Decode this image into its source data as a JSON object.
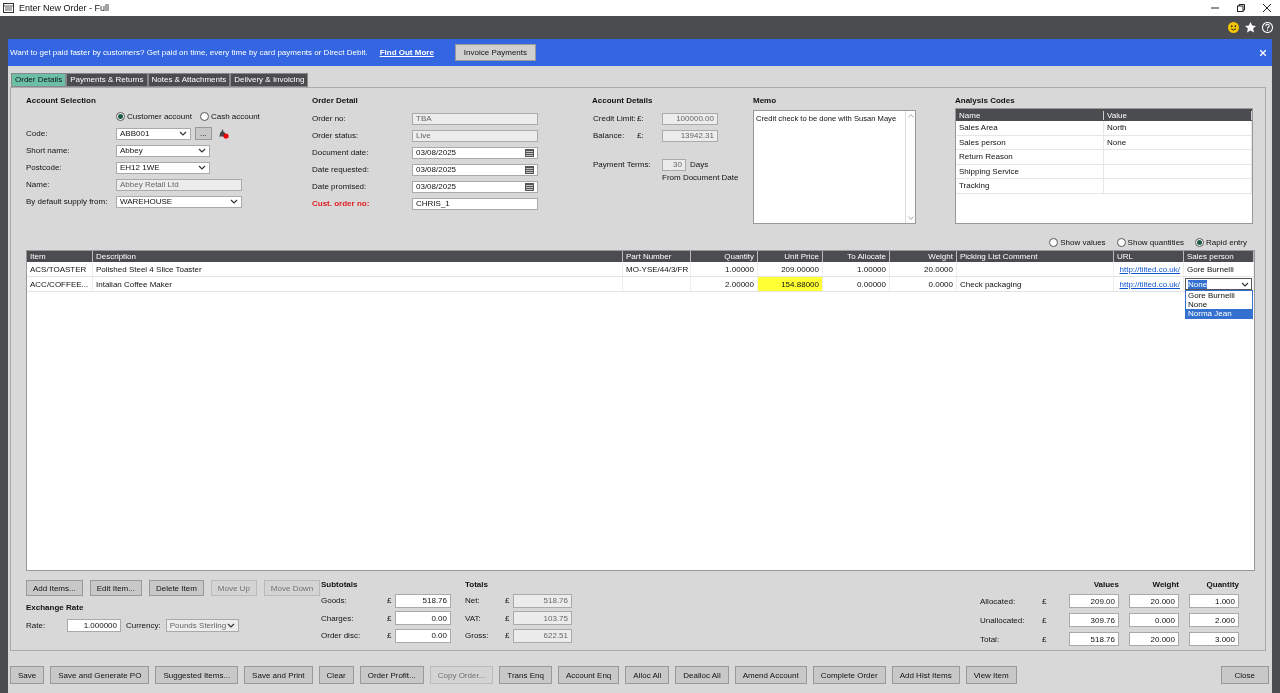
{
  "window": {
    "title": "Enter New Order - Full"
  },
  "banner": {
    "message": "Want to get paid faster by customers? Get paid on time, every time by card payments or Direct Debit.",
    "link": "Find Out More",
    "button": "Invoice Payments"
  },
  "tabs": [
    {
      "label": "Order Details",
      "selected": true
    },
    {
      "label": "Payments & Returns",
      "selected": false
    },
    {
      "label": "Notes & Attachments",
      "selected": false
    },
    {
      "label": "Delivery & Invoicing",
      "selected": false
    }
  ],
  "account_selection": {
    "title": "Account Selection",
    "lookup_button": "...",
    "account_types": [
      {
        "label": "Customer account",
        "selected": true
      },
      {
        "label": "Cash account",
        "selected": false
      }
    ],
    "fields": [
      {
        "label": "Code:",
        "value": "ABB001",
        "kind": "lookup"
      },
      {
        "label": "Short name:",
        "value": "Abbey",
        "kind": "dropdown"
      },
      {
        "label": "Postcode:",
        "value": "EH12 1WE",
        "kind": "dropdown"
      },
      {
        "label": "Name:",
        "value": "Abbey Retail Ltd",
        "kind": "readonly"
      },
      {
        "label": "By default supply from:",
        "value": "WAREHOUSE",
        "kind": "dropdown"
      }
    ]
  },
  "order_detail": {
    "title": "Order Detail",
    "fields": [
      {
        "label": "Order no:",
        "value": "TBA",
        "kind": "readonly",
        "required": false
      },
      {
        "label": "Order status:",
        "value": "Live",
        "kind": "readonly",
        "required": false
      },
      {
        "label": "Document date:",
        "value": "03/08/2025",
        "kind": "date",
        "required": false
      },
      {
        "label": "Date requested:",
        "value": "03/08/2025",
        "kind": "date",
        "required": false
      },
      {
        "label": "Date promised:",
        "value": "03/08/2025",
        "kind": "date",
        "required": false
      },
      {
        "label": "Cust. order no:",
        "value": "CHRIS_1",
        "kind": "text",
        "required": true
      }
    ]
  },
  "account_details": {
    "title": "Account Details",
    "fields": [
      {
        "label": "Credit Limit:",
        "currency": "£:",
        "value": "100000.00"
      },
      {
        "label": "Balance:",
        "currency": "£:",
        "value": "13942.31"
      }
    ],
    "payment_terms": {
      "label": "Payment Terms:",
      "value": "30",
      "unit": "Days",
      "note": "From Document Date"
    }
  },
  "memo": {
    "title": "Memo",
    "text": "Credit check to be done with Susan Maye"
  },
  "analysis_codes": {
    "title": "Analysis Codes",
    "columns": [
      "Name",
      "Value"
    ],
    "rows": [
      {
        "name": "Sales Area",
        "value": "North"
      },
      {
        "name": "Sales person",
        "value": "None"
      },
      {
        "name": "Return Reason"
      },
      {
        "name": "Shipping Service"
      },
      {
        "name": "Tracking"
      }
    ]
  },
  "view_modes": [
    {
      "label": "Show values",
      "selected": false
    },
    {
      "label": "Show quantities",
      "selected": false
    },
    {
      "label": "Rapid entry",
      "selected": true
    }
  ],
  "lines": {
    "columns": [
      "Item",
      "Description",
      "Part Number",
      "Quantity",
      "Unit Price",
      "To Allocate",
      "Weight",
      "Picking List Comment",
      "URL",
      "Sales person"
    ],
    "rows": [
      {
        "item": "ACS/TOASTER",
        "description": "Polished Steel 4 Slice Toaster",
        "part_number": "MO-YSE/44/3/FR",
        "quantity": "1.00000",
        "unit_price": "209.00000",
        "to_allocate": "1.00000",
        "weight": "20.0000",
        "url": "http://tilted.co.uk/",
        "sales_person": "Gore Burnelli",
        "price_warning": false,
        "editing": false
      },
      {
        "item": "ACC/COFFEE...",
        "description": "Intalian Coffee Maker",
        "quantity": "2.00000",
        "unit_price": "154.88000",
        "to_allocate": "0.00000",
        "weight": "0.0000",
        "comment": "Check packaging",
        "url": "http://tilted.co.uk/",
        "sales_person": "None",
        "price_warning": true,
        "editing": true,
        "options": [
          {
            "label": "Gore Burnelli",
            "selected": false
          },
          {
            "label": "None",
            "selected": false
          },
          {
            "label": "Norma Jean",
            "selected": true
          }
        ]
      }
    ]
  },
  "item_buttons": [
    {
      "label": "Add Items...",
      "disabled": false
    },
    {
      "label": "Edit Item...",
      "disabled": false
    },
    {
      "label": "Delete Item",
      "disabled": false
    },
    {
      "label": "Move Up",
      "disabled": true
    },
    {
      "label": "Move Down",
      "disabled": true
    }
  ],
  "exchange_rate": {
    "title": "Exchange Rate",
    "rate_label": "Rate:",
    "rate": "1.000000",
    "currency_label": "Currency:",
    "currency": "Pounds Sterling"
  },
  "subtotals": {
    "title": "Subtotals",
    "rows": [
      {
        "label": "Goods:",
        "currency": "£",
        "value": "518.76"
      },
      {
        "label": "Charges:",
        "currency": "£",
        "value": "0.00"
      },
      {
        "label": "Order disc:",
        "currency": "£",
        "value": "0.00"
      }
    ]
  },
  "totals": {
    "title": "Totals",
    "rows": [
      {
        "label": "Net:",
        "currency": "£",
        "value": "518.76"
      },
      {
        "label": "VAT:",
        "currency": "£",
        "value": "103.75"
      },
      {
        "label": "Gross:",
        "currency": "£",
        "value": "622.51"
      }
    ]
  },
  "allocation": {
    "columns": [
      "Values",
      "Weight",
      "Quantity"
    ],
    "rows": [
      {
        "label": "Allocated:",
        "currency": "£",
        "values": [
          "209.00",
          "20.000",
          "1.000"
        ]
      },
      {
        "label": "Unallocated:",
        "currency": "£",
        "values": [
          "309.76",
          "0.000",
          "2.000"
        ]
      },
      {
        "label": "Total:",
        "currency": "£",
        "values": [
          "518.76",
          "20.000",
          "3.000"
        ]
      }
    ]
  },
  "footer_buttons": [
    {
      "label": "Save",
      "disabled": false
    },
    {
      "label": "Save and Generate PO",
      "disabled": false
    },
    {
      "label": "Suggested Items...",
      "disabled": false
    },
    {
      "label": "Save and Print",
      "disabled": false
    },
    {
      "label": "Clear",
      "disabled": false
    },
    {
      "label": "Order Profit...",
      "disabled": false
    },
    {
      "label": "Copy Order...",
      "disabled": true
    },
    {
      "label": "Trans Enq",
      "disabled": false
    },
    {
      "label": "Account Enq",
      "disabled": false
    },
    {
      "label": "Alloc All",
      "disabled": false
    },
    {
      "label": "Dealloc All",
      "disabled": false
    },
    {
      "label": "Amend Account",
      "disabled": false
    },
    {
      "label": "Complete Order",
      "disabled": false
    },
    {
      "label": "Add Hist Items",
      "disabled": false
    },
    {
      "label": "View Item",
      "disabled": false
    }
  ],
  "close_button": "Close"
}
